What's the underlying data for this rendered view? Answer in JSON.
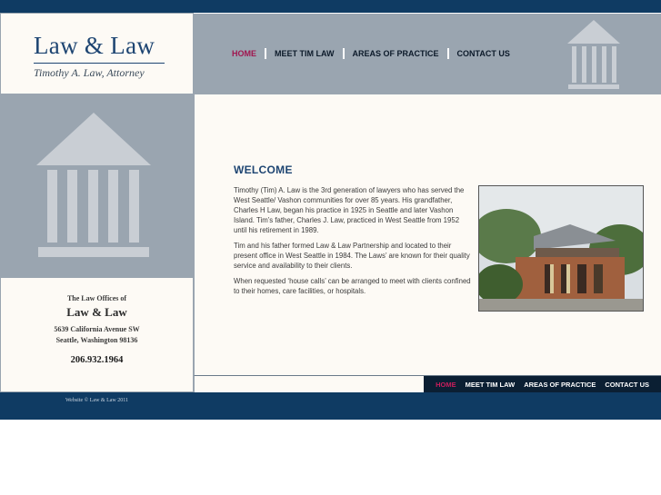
{
  "site": {
    "name": "Law & Law",
    "subtitle": "Timothy A. Law, Attorney"
  },
  "nav": {
    "items": [
      {
        "label": "HOME",
        "active": true
      },
      {
        "label": "MEET TIM LAW",
        "active": false
      },
      {
        "label": "AREAS OF PRACTICE",
        "active": false
      },
      {
        "label": "CONTACT US",
        "active": false
      }
    ]
  },
  "contact": {
    "offices_label": "The Law Offices of",
    "firm": "Law & Law",
    "address_line1": "5639 California Avenue SW",
    "address_line2": "Seattle, Washington 98136",
    "phone": "206.932.1964"
  },
  "main": {
    "heading": "WELCOME",
    "paragraphs": [
      "Timothy (Tim) A. Law is the 3rd generation of lawyers who has served the West Seattle/ Vashon communities for over 85 years. His grandfather, Charles H Law, began his practice in 1925 in Seattle and later Vashon Island. Tim’s father, Charles J. Law, practiced in West Seattle from 1952 until his retirement in 1989.",
      "Tim and his father formed Law & Law Partnership and located to their present office in West Seattle in 1984. The Laws’ are known for their quality service and availability to their clients.",
      "When requested ‘house calls’ can be arranged to meet with clients confined to their homes, care facilities, or hospitals."
    ]
  },
  "footer": {
    "text": "Website © Law & Law 2011"
  },
  "colors": {
    "navy": "#0f3b63",
    "slate": "#9aa5b0",
    "cream": "#fdfaf5",
    "active_nav": "#a0164f"
  },
  "icons": {
    "logo_temple": "temple-icon",
    "side_temple": "temple-icon"
  }
}
